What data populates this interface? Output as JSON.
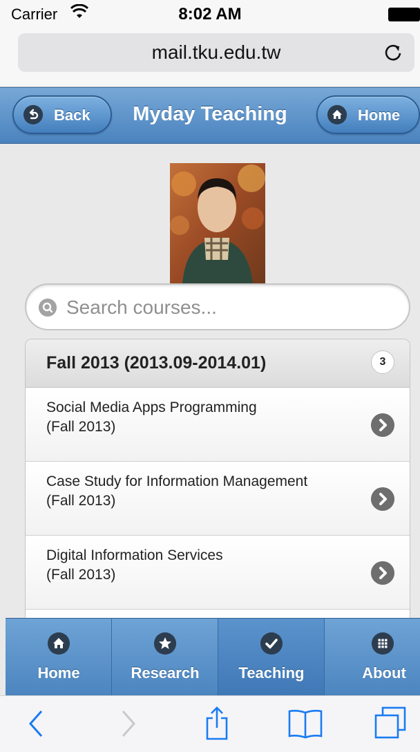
{
  "status_bar": {
    "carrier": "Carrier",
    "time": "8:02 AM"
  },
  "browser": {
    "url": "mail.tku.edu.tw"
  },
  "header": {
    "back_label": "Back",
    "title": "Myday Teaching",
    "home_label": "Home"
  },
  "search": {
    "placeholder": "Search courses..."
  },
  "course_list": {
    "divider_label": "Fall 2013 (2013.09-2014.01)",
    "count": "3",
    "items": [
      {
        "line1": "Social Media Apps Programming",
        "line2": "(Fall 2013)"
      },
      {
        "line1": "Case Study for Information Management",
        "line2": "(Fall 2013)"
      },
      {
        "line1": "Digital Information Services",
        "line2": "(Fall 2013)"
      }
    ]
  },
  "navbar": {
    "items": [
      {
        "label": "Home",
        "icon": "home-icon"
      },
      {
        "label": "Research",
        "icon": "star-icon"
      },
      {
        "label": "Teaching",
        "icon": "check-icon"
      },
      {
        "label": "About",
        "icon": "grid-icon"
      }
    ],
    "active": "Teaching"
  },
  "colors": {
    "header_blue": "#5a91c9",
    "accent_ios": "#1a7bf2"
  }
}
